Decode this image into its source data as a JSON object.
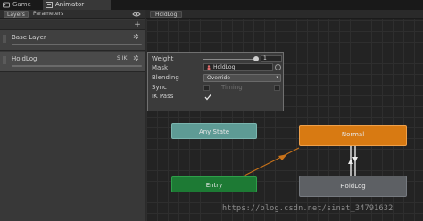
{
  "window": {
    "tabs": [
      {
        "label": "Game",
        "icon": "game-icon"
      },
      {
        "label": "Animator",
        "icon": "animator-icon",
        "active": true
      }
    ]
  },
  "left_panel": {
    "subtabs": [
      "Layers",
      "Parameters"
    ],
    "layers": [
      {
        "name": "Base Layer",
        "flags": ""
      },
      {
        "name": "HoldLog",
        "flags": "S IK",
        "selected": true
      }
    ]
  },
  "graph": {
    "breadcrumb": "HoldLog",
    "layer_settings": {
      "weight_label": "Weight",
      "weight_value": "1",
      "mask_label": "Mask",
      "mask_value": "HoldLog",
      "blending_label": "Blending",
      "blending_value": "Override",
      "sync_label": "Sync",
      "timing_label": "Timing",
      "ik_pass_label": "IK Pass",
      "ik_pass_checked": true
    },
    "states": {
      "any_state": "Any State",
      "entry": "Entry",
      "normal": "Normal",
      "holdlog": "HoldLog"
    }
  },
  "watermark": "https://blog.csdn.net/sinat_34791632",
  "colors": {
    "any_state": "#5e9b95",
    "entry": "#1d7a34",
    "default_state": "#d87a12",
    "state": "#5d6064",
    "transition_default": "#c9731a",
    "transition": "#e0e0e0"
  }
}
